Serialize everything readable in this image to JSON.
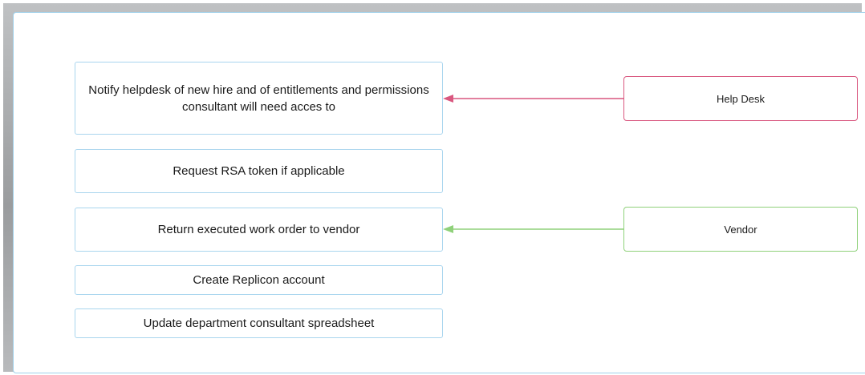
{
  "diagram": {
    "tasks": [
      {
        "id": "notify-helpdesk",
        "label": "Notify helpdesk of new hire and of entitlements and permissions consultant will need acces to"
      },
      {
        "id": "request-rsa",
        "label": "Request RSA token if applicable"
      },
      {
        "id": "return-work-order",
        "label": "Return executed work order to vendor"
      },
      {
        "id": "create-replicon",
        "label": "Create Replicon account"
      },
      {
        "id": "update-spreadsheet",
        "label": "Update department consultant spreadsheet"
      }
    ],
    "actors": [
      {
        "id": "help-desk",
        "label": "Help Desk",
        "color": "#d9577f"
      },
      {
        "id": "vendor",
        "label": "Vendor",
        "color": "#8fd17a"
      }
    ],
    "connections": [
      {
        "from": "help-desk",
        "to": "notify-helpdesk",
        "color": "#d9577f"
      },
      {
        "from": "vendor",
        "to": "return-work-order",
        "color": "#8fd17a"
      }
    ]
  }
}
